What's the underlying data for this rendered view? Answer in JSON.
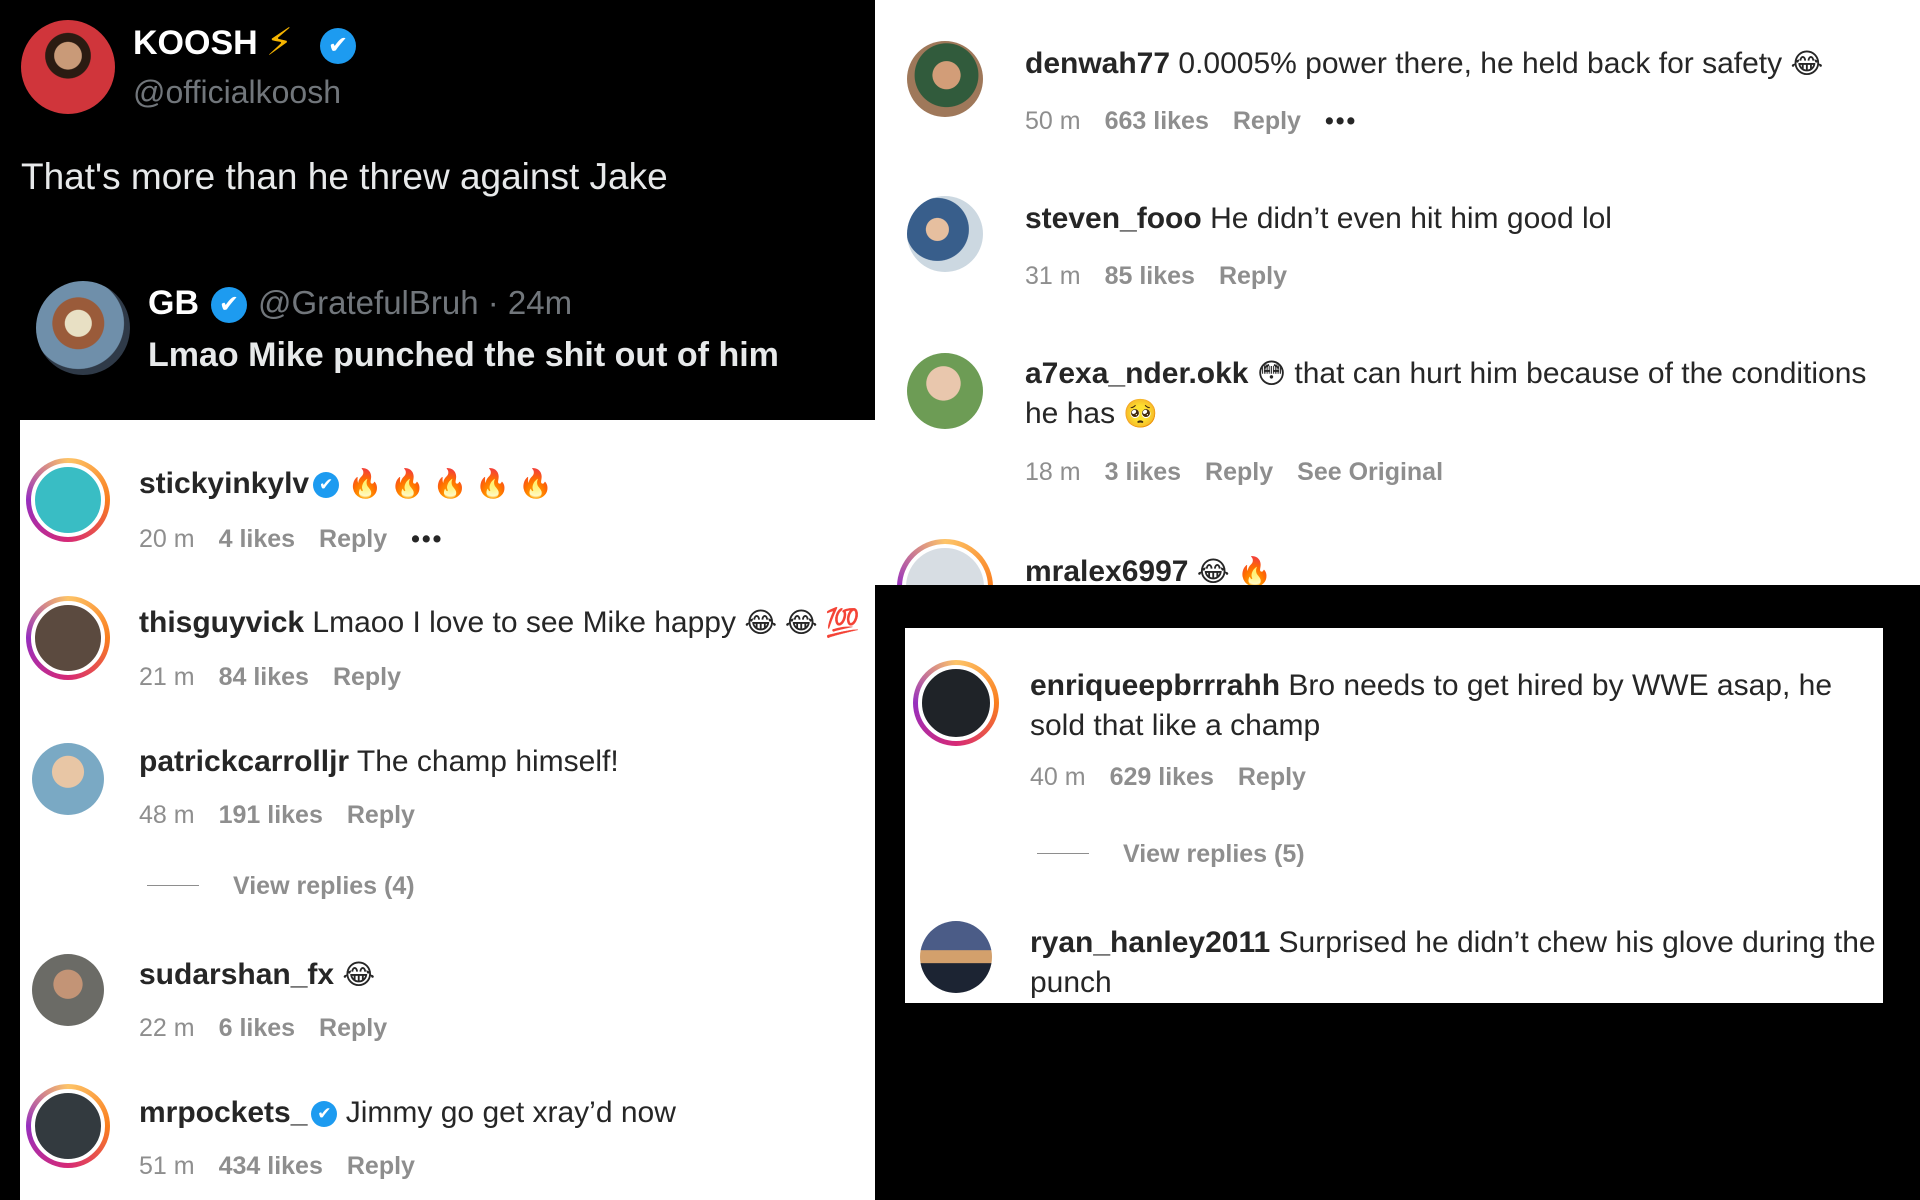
{
  "tweet": {
    "name": "KOOSH",
    "name_emoji": "⚡",
    "verified_icon": "✔",
    "handle": "@officialkoosh",
    "text": "That's more than he threw against Jake",
    "quoted": {
      "name": "GB",
      "verified_icon": "✔",
      "meta": "@GratefulBruh · 24m",
      "text": "Lmao Mike punched the shit out of him"
    }
  },
  "left_comments": [
    {
      "user": "stickyinkylv",
      "verified": "✔",
      "text": "",
      "emoji": "🔥 🔥 🔥 🔥 🔥",
      "time": "20 m",
      "likes": "4 likes",
      "reply": "Reply",
      "more": "•••"
    },
    {
      "user": "thisguyvick",
      "text": "Lmaoo I love to see Mike happy",
      "emoji": "😂 😂 💯",
      "time": "21 m",
      "likes": "84 likes",
      "reply": "Reply"
    },
    {
      "user": "patrickcarrolljr",
      "text": "The champ himself!",
      "time": "48 m",
      "likes": "191 likes",
      "reply": "Reply",
      "view_replies": "View replies (4)"
    },
    {
      "user": "sudarshan_fx",
      "emoji": "😂",
      "time": "22 m",
      "likes": "6 likes",
      "reply": "Reply"
    },
    {
      "user": "mrpockets_",
      "verified": "✔",
      "text": "Jimmy go get xray’d now",
      "time": "51 m",
      "likes": "434 likes",
      "reply": "Reply"
    }
  ],
  "right_top_comments": [
    {
      "user": "denwah77",
      "text": "0.0005% power there, he held back for safety",
      "emoji": "😂",
      "time": "50 m",
      "likes": "663 likes",
      "reply": "Reply",
      "more": "•••"
    },
    {
      "user": "steven_fooo",
      "text": "He didn’t even hit him good lol",
      "time": "31 m",
      "likes": "85 likes",
      "reply": "Reply"
    },
    {
      "user": "a7exa_nder.okk",
      "emoji_before": "😳",
      "text": "that can hurt him because of the conditions he has",
      "emoji": "🥺",
      "time": "18 m",
      "likes": "3 likes",
      "reply": "Reply",
      "see_original": "See Original"
    },
    {
      "user": "mralex6997",
      "emoji": "😂 🔥"
    }
  ],
  "right_bottom_comments": [
    {
      "user": "enriqueepbrrrahh",
      "text": "Bro needs to get hired by WWE asap, he sold that like a champ",
      "time": "40 m",
      "likes": "629 likes",
      "reply": "Reply",
      "view_replies": "View replies (5)"
    },
    {
      "user": "ryan_hanley2011",
      "text": "Surprised he didn’t chew his glove during the punch"
    }
  ],
  "colors": {
    "twitter_blue": "#1d9bf0",
    "instagram_text": "#262626",
    "instagram_meta": "#8e8e8e",
    "twitter_secondary": "#71767b"
  }
}
